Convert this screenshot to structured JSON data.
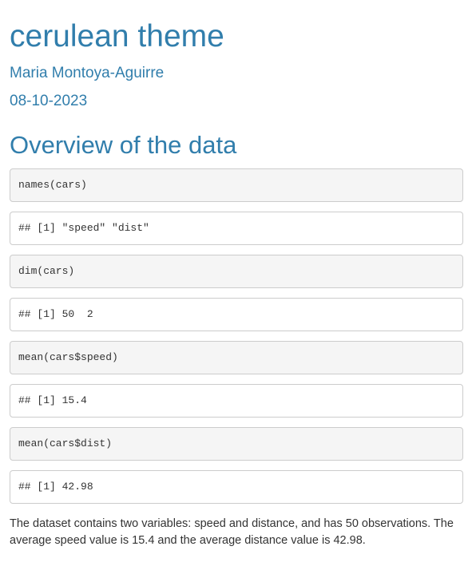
{
  "title": "cerulean theme",
  "author": "Maria Montoya-Aguirre",
  "date": "08-10-2023",
  "section_heading": "Overview of the data",
  "blocks": [
    {
      "kind": "code",
      "text": "names(cars)"
    },
    {
      "kind": "output",
      "text": "## [1] \"speed\" \"dist\""
    },
    {
      "kind": "code",
      "text": "dim(cars)"
    },
    {
      "kind": "output",
      "text": "## [1] 50  2"
    },
    {
      "kind": "code",
      "text": "mean(cars$speed)"
    },
    {
      "kind": "output",
      "text": "## [1] 15.4"
    },
    {
      "kind": "code",
      "text": "mean(cars$dist)"
    },
    {
      "kind": "output",
      "text": "## [1] 42.98"
    }
  ],
  "summary": "The dataset contains two variables: speed and distance, and has 50 observations. The average speed value is 15.4 and the average distance value is 42.98.",
  "colors": {
    "heading": "#317eac",
    "code_background": "#f5f5f5",
    "block_border": "#cccccc"
  }
}
